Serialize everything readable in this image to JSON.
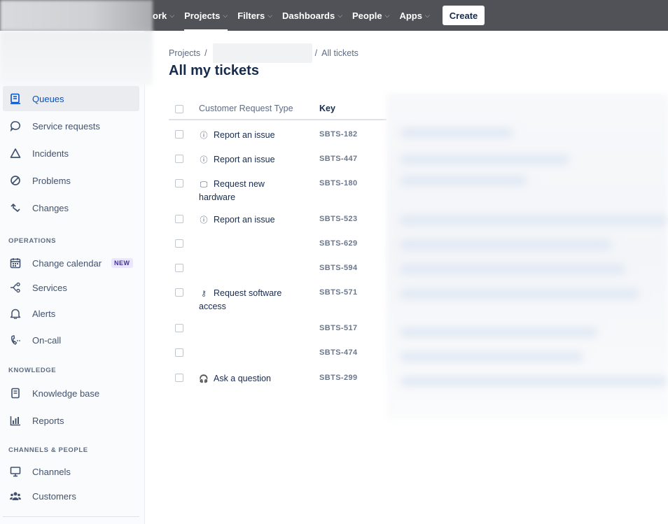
{
  "topnav": {
    "items": [
      {
        "label": "ork",
        "chevron": true
      },
      {
        "label": "Projects",
        "chevron": true,
        "active": true
      },
      {
        "label": "Filters",
        "chevron": true
      },
      {
        "label": "Dashboards",
        "chevron": true
      },
      {
        "label": "People",
        "chevron": true
      },
      {
        "label": "Apps",
        "chevron": true
      }
    ],
    "create_label": "Create"
  },
  "sidebar": {
    "items": [
      {
        "label": "Queues",
        "icon": "queues-icon",
        "active": true
      },
      {
        "label": "Service requests",
        "icon": "speech-bubble-icon"
      },
      {
        "label": "Incidents",
        "icon": "triangle-icon"
      },
      {
        "label": "Problems",
        "icon": "prohibited-icon"
      },
      {
        "label": "Changes",
        "icon": "changes-icon"
      }
    ],
    "sections": [
      {
        "title": "OPERATIONS",
        "items": [
          {
            "label": "Change calendar",
            "icon": "calendar-icon",
            "badge": "NEW"
          },
          {
            "label": "Services",
            "icon": "services-icon"
          },
          {
            "label": "Alerts",
            "icon": "bell-icon"
          },
          {
            "label": "On-call",
            "icon": "phone-icon"
          }
        ]
      },
      {
        "title": "KNOWLEDGE",
        "items": [
          {
            "label": "Knowledge base",
            "icon": "book-icon"
          },
          {
            "label": "Reports",
            "icon": "bar-chart-icon"
          }
        ]
      },
      {
        "title": "CHANNELS & PEOPLE",
        "items": [
          {
            "label": "Channels",
            "icon": "monitor-icon"
          },
          {
            "label": "Customers",
            "icon": "people-icon"
          }
        ]
      }
    ]
  },
  "breadcrumb": {
    "first": "Projects",
    "sep1": "/",
    "sep2": "/",
    "last": "All tickets"
  },
  "page_title": "All my tickets",
  "table": {
    "columns": [
      "Customer Request Type",
      "Key"
    ],
    "rows": [
      {
        "type": "Report an issue",
        "icon": "alert-circle-icon",
        "key": "SBTS-182"
      },
      {
        "type": "Report an issue",
        "icon": "alert-circle-icon",
        "key": "SBTS-447"
      },
      {
        "type": "Request new hardware",
        "icon": "hardware-icon",
        "key": "SBTS-180"
      },
      {
        "type": "Report an issue",
        "icon": "alert-circle-icon",
        "key": "SBTS-523"
      },
      {
        "type": "",
        "icon": "",
        "key": "SBTS-629"
      },
      {
        "type": "",
        "icon": "",
        "key": "SBTS-594"
      },
      {
        "type": "Request software access",
        "icon": "key-icon",
        "key": "SBTS-571"
      },
      {
        "type": "",
        "icon": "",
        "key": "SBTS-517"
      },
      {
        "type": "",
        "icon": "",
        "key": "SBTS-474"
      },
      {
        "type": "Ask a question",
        "icon": "headset-icon",
        "key": "SBTS-299"
      }
    ]
  },
  "colors": {
    "topbar": "#505258",
    "accent": "#0052cc",
    "badge_bg": "#eae6ff",
    "badge_fg": "#403294"
  }
}
